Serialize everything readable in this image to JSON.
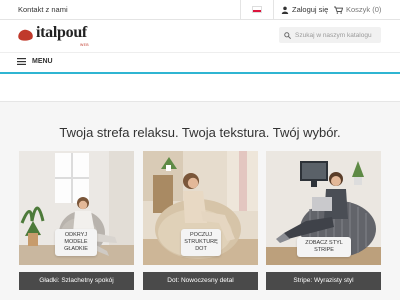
{
  "topbar": {
    "contact": "Kontakt z nami",
    "login": "Zaloguj się",
    "cart": "Koszyk (0)"
  },
  "header": {
    "logo_text": "italpouf",
    "logo_sub": "WEB",
    "search_placeholder": "Szukaj w naszym katalogu"
  },
  "nav": {
    "menu_label": "MENU"
  },
  "hero": {
    "tagline": "Twoja strefa relaksu. Twoja tekstura. Twój wybór."
  },
  "cards": [
    {
      "cta": "ODKRYJ MODELE GŁADKIE",
      "caption": "Gładki: Szlachetny spokój"
    },
    {
      "cta": "POCZUJ STRUKTURĘ DOT",
      "caption": "Dot: Nowoczesny detal"
    },
    {
      "cta": "ZOBACZ STYL STRIPE",
      "caption": "Stripe: Wyrazisty styl"
    }
  ],
  "colors": {
    "accent": "#2fb5d2",
    "caption_bg": "#4a4a4a",
    "logo_red": "#c0392b"
  },
  "icons": [
    "poland-flag-icon",
    "user-icon",
    "cart-icon",
    "search-icon",
    "hamburger-icon"
  ]
}
